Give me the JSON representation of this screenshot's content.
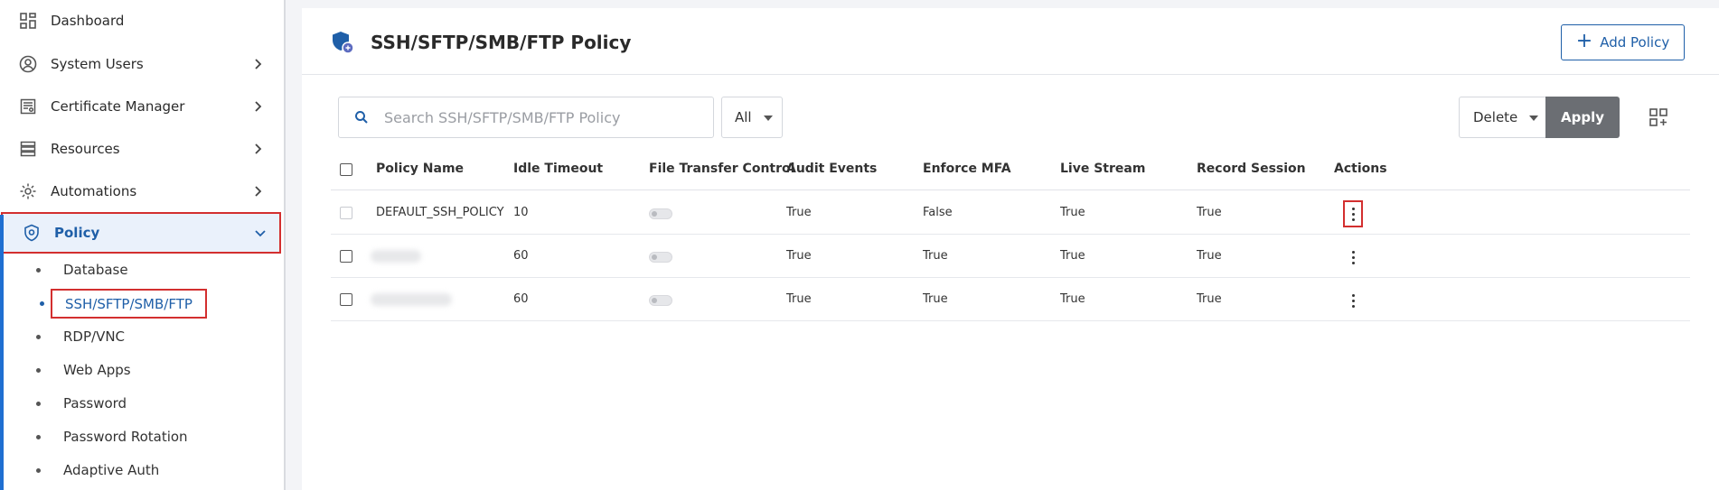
{
  "sidebar": {
    "nav": [
      {
        "label": "Dashboard",
        "icon": "dashboard-icon",
        "has_chevron": false
      },
      {
        "label": "System Users",
        "icon": "user-circle-icon",
        "has_chevron": true
      },
      {
        "label": "Certificate Manager",
        "icon": "certificate-icon",
        "has_chevron": true
      },
      {
        "label": "Resources",
        "icon": "server-icon",
        "has_chevron": true
      },
      {
        "label": "Automations",
        "icon": "gear-icon",
        "has_chevron": true
      },
      {
        "label": "Policy",
        "icon": "shield-icon",
        "has_chevron": true,
        "expanded": true
      }
    ],
    "policy_sub": [
      {
        "label": "Database"
      },
      {
        "label": "SSH/SFTP/SMB/FTP",
        "active": true
      },
      {
        "label": "RDP/VNC"
      },
      {
        "label": "Web Apps"
      },
      {
        "label": "Password"
      },
      {
        "label": "Password Rotation"
      },
      {
        "label": "Adaptive Auth"
      }
    ]
  },
  "header": {
    "title": "SSH/SFTP/SMB/FTP Policy",
    "add_label": "Add Policy"
  },
  "toolbar": {
    "search_placeholder": "Search SSH/SFTP/SMB/FTP Policy",
    "filter_value": "All",
    "bulk_action": "Delete",
    "apply_label": "Apply"
  },
  "table": {
    "columns": [
      "Policy Name",
      "Idle Timeout",
      "File Transfer Control",
      "Audit Events",
      "Enforce MFA",
      "Live Stream",
      "Record Session",
      "Actions"
    ],
    "rows": [
      {
        "name": "DEFAULT_SSH_POLICY",
        "idle_timeout": "10",
        "file_transfer": false,
        "audit_events": "True",
        "enforce_mfa": "False",
        "live_stream": "True",
        "record_session": "True"
      },
      {
        "name": "",
        "idle_timeout": "60",
        "file_transfer": false,
        "audit_events": "True",
        "enforce_mfa": "True",
        "live_stream": "True",
        "record_session": "True"
      },
      {
        "name": "",
        "idle_timeout": "60",
        "file_transfer": false,
        "audit_events": "True",
        "enforce_mfa": "True",
        "live_stream": "True",
        "record_session": "True"
      }
    ]
  },
  "colors": {
    "accent": "#1f5fa8",
    "highlight": "#d32f2f",
    "apply_bg": "#6b6e73"
  }
}
